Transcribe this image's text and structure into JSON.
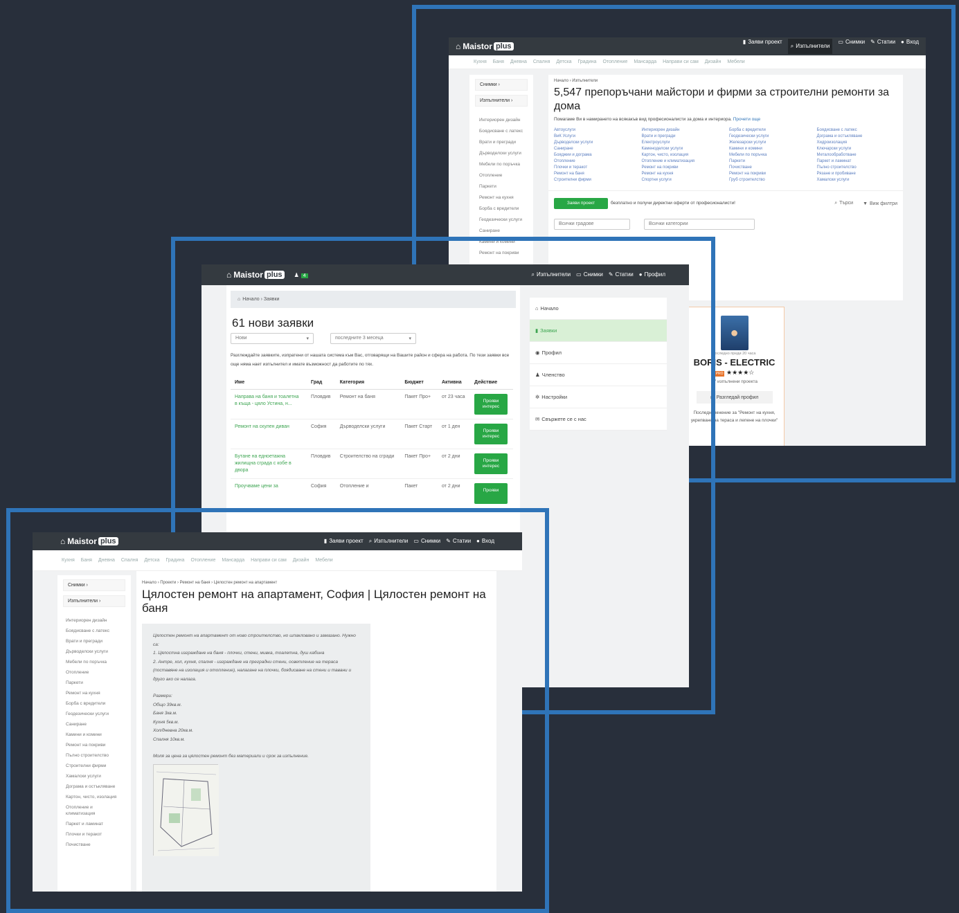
{
  "common": {
    "logo": "Maistor",
    "logo_plus": "plus",
    "nav_requests": "Заяви проект",
    "nav_pros": "Изпълнители",
    "nav_photos": "Снимки",
    "nav_articles": "Статии",
    "nav_login": "Вход",
    "nav_profile": "Профил",
    "categories": [
      "Кухня",
      "Баня",
      "Дневна",
      "Спалня",
      "Детска",
      "Градина",
      "Отопление",
      "Мансарда",
      "Направи си сам",
      "Дизайн",
      "Мебели"
    ],
    "side_photos": "Снимки ›",
    "side_pros": "Изпълнители ›"
  },
  "shot1": {
    "crumb": "Начало › Изпълнители",
    "title": "5,547 препоръчани майстори и фирми за строителни ремонти за дома",
    "intro": "Помагаме Ви в намирането на всякакъв вид професионалисти за дома и интериора.",
    "intro_link": "Прочети още",
    "side_links": [
      "Интериорен дизайн",
      "Боядисване с латекс",
      "Врати и прегради",
      "Дърводелски услуги",
      "Мебели по поръчка",
      "Отопление",
      "Паркети",
      "Ремонт на кухня",
      "Борба с вредители",
      "Геодезически услуги",
      "Саниране",
      "Камини и комини",
      "Ремонт на покриви"
    ],
    "col1": [
      "Автоуслуги",
      "ВиК Услуги",
      "Дърводелски услуги",
      "Саниране",
      "Бояджии и дограма",
      "Отопление",
      "Плочки и теракот",
      "Ремонт на баня",
      "Строителни фирми"
    ],
    "col2": [
      "Интериорен дизайн",
      "Врати и прегради",
      "Електроуслуги",
      "Каменоделски услуги",
      "Картон, чисто, изолация",
      "Отопление и климатизация",
      "Ремонт на покриви",
      "Ремонт на кухня",
      "Спортни услуги"
    ],
    "col3": [
      "Борба с вредители",
      "Геодезически услуги",
      "Железарски услуги",
      "Камини и комини",
      "Мебели по поръчка",
      "Паркети",
      "Почистване",
      "Ремонт на покриви",
      "Груб строителство"
    ],
    "col4": [
      "Боядисване с латекс",
      "Дограма и остъкляване",
      "Хидроизолация",
      "Ключарски услуги",
      "Металообработване",
      "Паркет и ламинат",
      "Пълно строителство",
      "Рязане и пробиване",
      "Хамалски услуги"
    ],
    "cta_btn": "Заяви проект",
    "cta_text": "безплатно и получи директни оферти от професионалисти!",
    "search": "Търси",
    "filters": "Виж филтри",
    "select1": "Всички градове",
    "select2": "Всички категории",
    "pro_meta": "последно преди 20 часа",
    "pro_name": "BORIS - ELECTRIC",
    "pro_badge": "PRO",
    "pro_stars": "★★★★☆",
    "pro_projects": "57 изпълнени проекта",
    "pro_view": "Разгледай профил",
    "pro_review": "Последно мнение за \"Ремонт на кухня, укрепване на тераса и лепене на плочки\""
  },
  "shot2": {
    "badge": "4",
    "crumb_home": "Начало",
    "crumb_current": "Заявки",
    "title": "61 нови заявки",
    "filter1": "Нови",
    "filter2": "последните 3 месеца",
    "intro": "Разглеждайте заявките, изпратени от нашата система към Вас, отговарящи на Вашите район и сфера на работа. По тези заявки все още няма нает изпълнител и имате възможност да работите по тях.",
    "headers": [
      "Име",
      "Град",
      "Категория",
      "Бюджет",
      "Активна",
      "Действие"
    ],
    "rows": [
      {
        "name": "Направа на баня и тоалетна в къща - цяло Устина, н...",
        "city": "Пловдив",
        "cat": "Ремонт на баня",
        "budget": "Пакет Про+",
        "active": "от 23 часа",
        "action": "Прояви интерес"
      },
      {
        "name": "Ремонт на скулен диван",
        "city": "София",
        "cat": "Дърводелски услуги",
        "budget": "Пакет Старт",
        "active": "от 1 ден",
        "action": "Прояви интерес"
      },
      {
        "name": "Бутане на едноетажна жилищна сграда с кобе в двора",
        "city": "Пловдив",
        "cat": "Строителство на сгради",
        "budget": "Пакет Про+",
        "active": "от 2 дни",
        "action": "Прояви интерес"
      },
      {
        "name": "Проучваме цени за",
        "city": "София",
        "cat": "Отопление и",
        "budget": "Пакет",
        "active": "от 2 дни",
        "action": "Прояви"
      }
    ],
    "menu": [
      "Начало",
      "Заявки",
      "Профил",
      "Членство",
      "Настройки",
      "Свържете се с нас"
    ]
  },
  "shot3": {
    "crumb": "Начало › Проекти › Ремонт на баня › Цялостен ремонт на апартамент",
    "title": "Цялостен ремонт на апартамент, София | Цялостен ремонт на баня",
    "side_links": [
      "Интериорен дизайн",
      "Боядисване с латекс",
      "Врати и прегради",
      "Дърводелски услуги",
      "Мебели по поръчка",
      "Отопление",
      "Паркети",
      "Ремонт на кухня",
      "Борба с вредители",
      "Геодезически услуги",
      "Саниране",
      "Камини и комини",
      "Ремонт на покриви",
      "Пълно строителство",
      "Строителни фирми",
      "Хамалски услуги",
      "Дограма и остъкляване",
      "Картон, чисто, изолация",
      "Отопление и климатизация",
      "Паркет и ламинат",
      "Плочки и теракот",
      "Почистване"
    ],
    "desc": [
      "Цялостен ремонт на апартамент от ново строителство, но шпакловано и замазано. Нужно са:",
      "1. Цялостна изграждане на баня - плочки, стени, мивка, тоалетна, душ кабина",
      "2. Антре, хол, кухня, спалня - изграждане на преградни стени, осветление на тераса (поставяне на изолация и отопление), налагане на плочки, боядисване на стени и тавани и друго ако се налага.",
      "",
      "Размери:",
      "Общо 39кв.м.",
      "Баня 3кв.м.",
      "Кухня 5кв.м.",
      "Хол/дневна 20кв.м.",
      "Спалня 10кв.м.",
      "",
      "Моля за цена за цялостен ремонт без материали и срок за изпълнение."
    ]
  }
}
